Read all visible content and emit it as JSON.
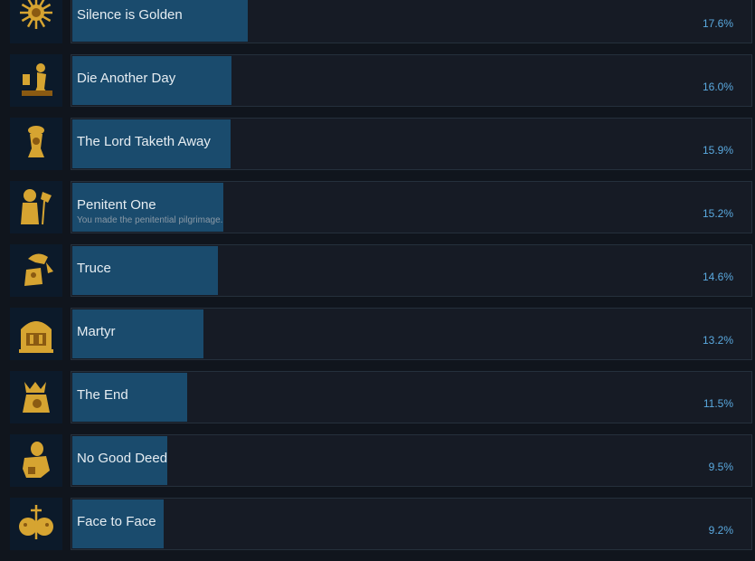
{
  "achievements": [
    {
      "title": "Silence is Golden",
      "description": "",
      "percent_text": "17.6%",
      "percent": 17.6,
      "icon": "sun-face-icon"
    },
    {
      "title": "Die Another Day",
      "description": "",
      "percent_text": "16.0%",
      "percent": 16.0,
      "icon": "kneeling-figure-icon"
    },
    {
      "title": "The Lord Taketh Away",
      "description": "",
      "percent_text": "15.9%",
      "percent": 15.9,
      "icon": "hanging-figure-icon"
    },
    {
      "title": "Penitent One",
      "description": "You made the penitential pilgrimage.",
      "percent_text": "15.2%",
      "percent": 15.2,
      "icon": "pilgrim-icon"
    },
    {
      "title": "Truce",
      "description": "",
      "percent_text": "14.6%",
      "percent": 14.6,
      "icon": "beast-icon"
    },
    {
      "title": "Martyr",
      "description": "",
      "percent_text": "13.2%",
      "percent": 13.2,
      "icon": "altar-icon"
    },
    {
      "title": "The End",
      "description": "",
      "percent_text": "11.5%",
      "percent": 11.5,
      "icon": "crowned-figure-icon"
    },
    {
      "title": "No Good Deed",
      "description": "",
      "percent_text": "9.5%",
      "percent": 9.5,
      "icon": "crouching-figure-icon"
    },
    {
      "title": "Face to Face",
      "description": "",
      "percent_text": "9.2%",
      "percent": 9.2,
      "icon": "two-faces-icon"
    }
  ],
  "colors": {
    "bar": "#1a4b6d",
    "percent_text": "#5aa9df",
    "icon_gold": "#d6a431"
  }
}
